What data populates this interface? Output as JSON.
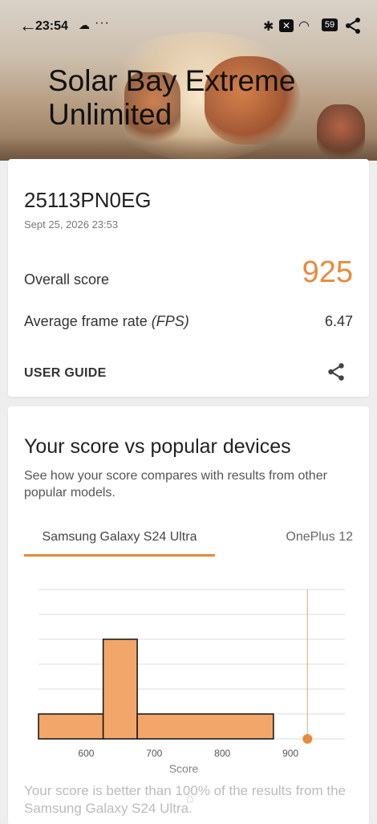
{
  "status_bar": {
    "time": "23:54",
    "battery": "59"
  },
  "header": {
    "title": "Solar Bay Extreme Unlimited"
  },
  "result": {
    "device": "25113PN0EG",
    "date": "Sept 25, 2026 23:53",
    "overall_label": "Overall score",
    "overall_value": "925",
    "fps_label_main": "Average frame rate ",
    "fps_label_unit": "(FPS)",
    "fps_value": "6.47",
    "user_guide": "USER GUIDE"
  },
  "comparison": {
    "title": "Your score vs popular devices",
    "description": "See how your score compares with results from other popular models.",
    "tabs": [
      {
        "label": "Samsung Galaxy S24 Ultra",
        "selected": true
      },
      {
        "label": "OnePlus 12",
        "selected": false
      }
    ],
    "footer": "Your score is better than 100% of the results from the Samsung Galaxy S24 Ultra."
  },
  "colors": {
    "accent": "#e78a3c",
    "bar_fill": "#f3a66a",
    "bar_stroke": "#111111"
  },
  "chart_data": {
    "type": "bar",
    "xlabel": "Score",
    "x_ticks": [
      600,
      700,
      800,
      900
    ],
    "xlim": [
      530,
      980
    ],
    "bins": [
      {
        "from": 530,
        "to": 625,
        "value": 1
      },
      {
        "from": 625,
        "to": 675,
        "value": 4
      },
      {
        "from": 675,
        "to": 875,
        "value": 1
      }
    ],
    "ylim": [
      0,
      6
    ],
    "grid": true,
    "your_score": 925
  }
}
